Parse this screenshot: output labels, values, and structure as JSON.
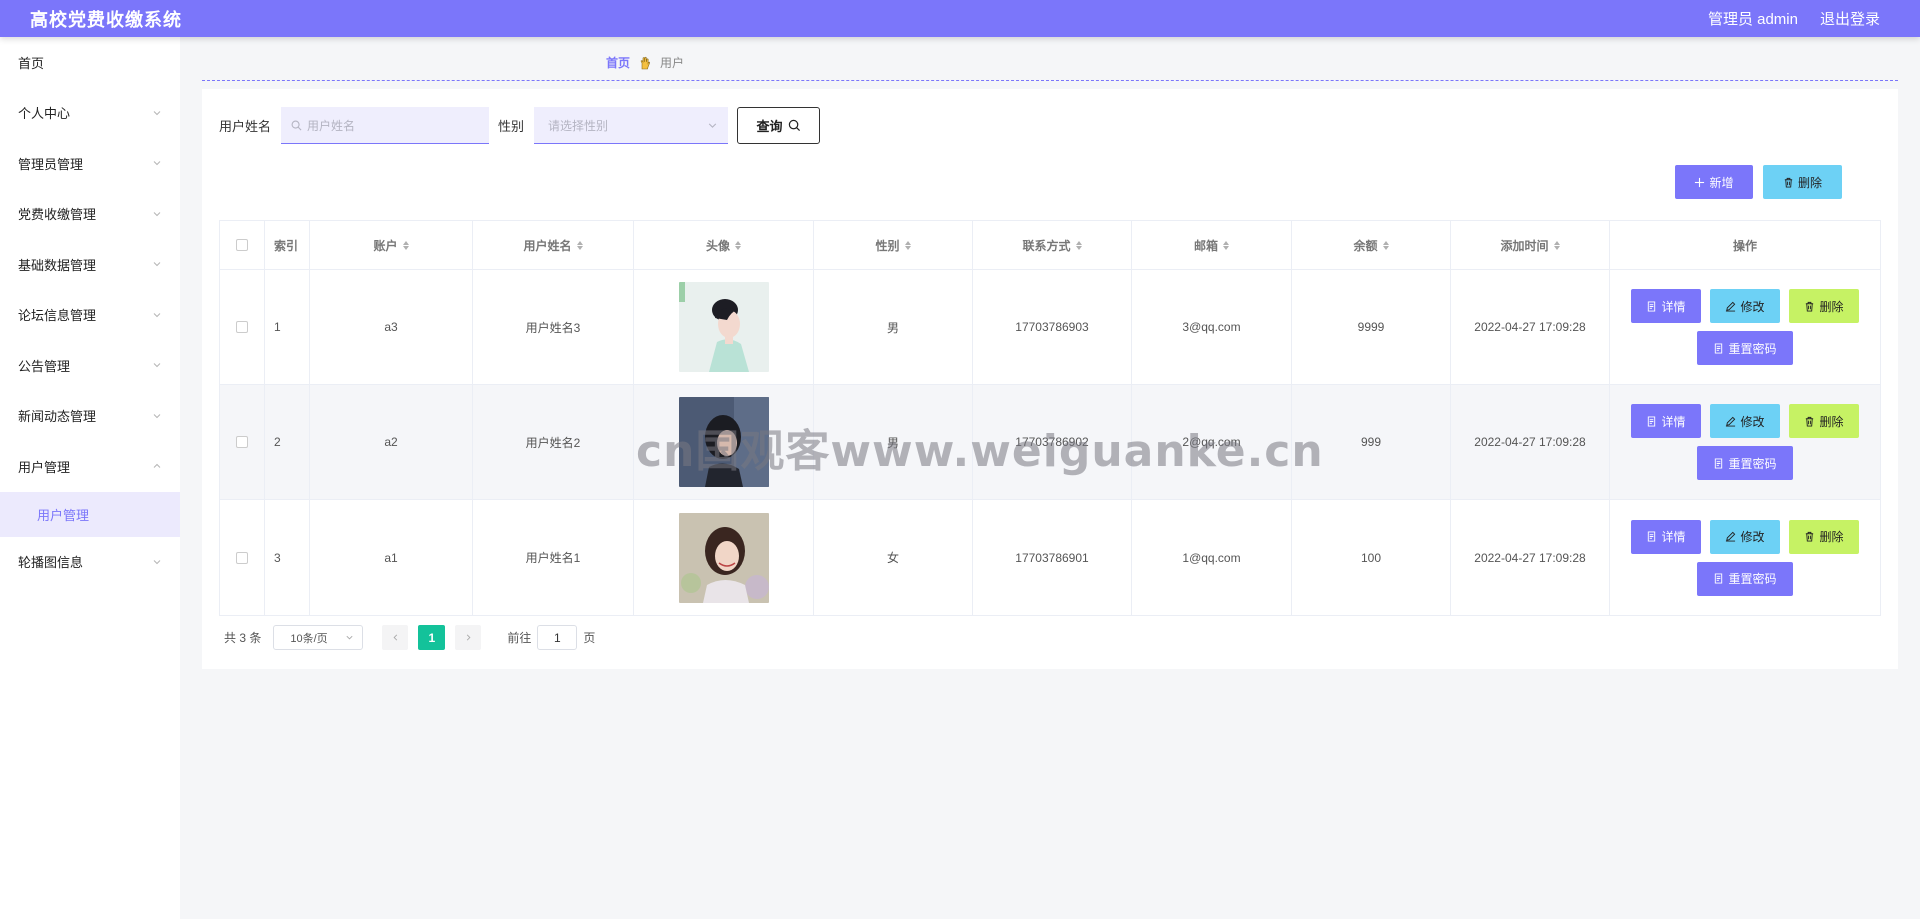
{
  "header": {
    "app_title": "高校党费收缴系统",
    "admin_label": "管理员 admin",
    "logout_label": "退出登录"
  },
  "sidebar": {
    "items": [
      {
        "label": "首页",
        "has_arrow": false
      },
      {
        "label": "个人中心",
        "has_arrow": true
      },
      {
        "label": "管理员管理",
        "has_arrow": true
      },
      {
        "label": "党费收缴管理",
        "has_arrow": true
      },
      {
        "label": "基础数据管理",
        "has_arrow": true
      },
      {
        "label": "论坛信息管理",
        "has_arrow": true
      },
      {
        "label": "公告管理",
        "has_arrow": true
      },
      {
        "label": "新闻动态管理",
        "has_arrow": true
      },
      {
        "label": "用户管理",
        "has_arrow": true,
        "expanded": true
      },
      {
        "label": "轮播图信息",
        "has_arrow": true
      }
    ],
    "sub_item": "用户管理"
  },
  "breadcrumb": {
    "home": "首页",
    "current": "用户"
  },
  "search": {
    "name_label": "用户姓名",
    "name_placeholder": "用户姓名",
    "sex_label": "性别",
    "sex_placeholder": "请选择性别",
    "query_label": "查询"
  },
  "toolbar": {
    "add_label": "新增",
    "delete_label": "删除"
  },
  "table": {
    "columns": [
      "索引",
      "账户",
      "用户姓名",
      "头像",
      "性别",
      "联系方式",
      "邮箱",
      "余额",
      "添加时间",
      "操作"
    ],
    "rows": [
      {
        "index": "1",
        "account": "a3",
        "name": "用户姓名3",
        "sex": "男",
        "phone": "17703786903",
        "email": "3@qq.com",
        "balance": "9999",
        "time": "2022-04-27 17:09:28"
      },
      {
        "index": "2",
        "account": "a2",
        "name": "用户姓名2",
        "sex": "男",
        "phone": "17703786902",
        "email": "2@qq.com",
        "balance": "999",
        "time": "2022-04-27 17:09:28"
      },
      {
        "index": "3",
        "account": "a1",
        "name": "用户姓名1",
        "sex": "女",
        "phone": "17703786901",
        "email": "1@qq.com",
        "balance": "100",
        "time": "2022-04-27 17:09:28"
      }
    ],
    "actions": {
      "detail": "详情",
      "edit": "修改",
      "delete": "删除",
      "reset": "重置密码"
    }
  },
  "pager": {
    "total": "共 3 条",
    "page_size": "10条/页",
    "current_page": "1",
    "goto_label": "前往",
    "goto_value": "1",
    "page_suffix": "页"
  },
  "watermark": "cn国观客www.weiguanke.cn",
  "colors": {
    "primary": "#7b76fa",
    "info": "#6dd1f5",
    "lime": "#c6f264",
    "page_active": "#13c29a"
  }
}
